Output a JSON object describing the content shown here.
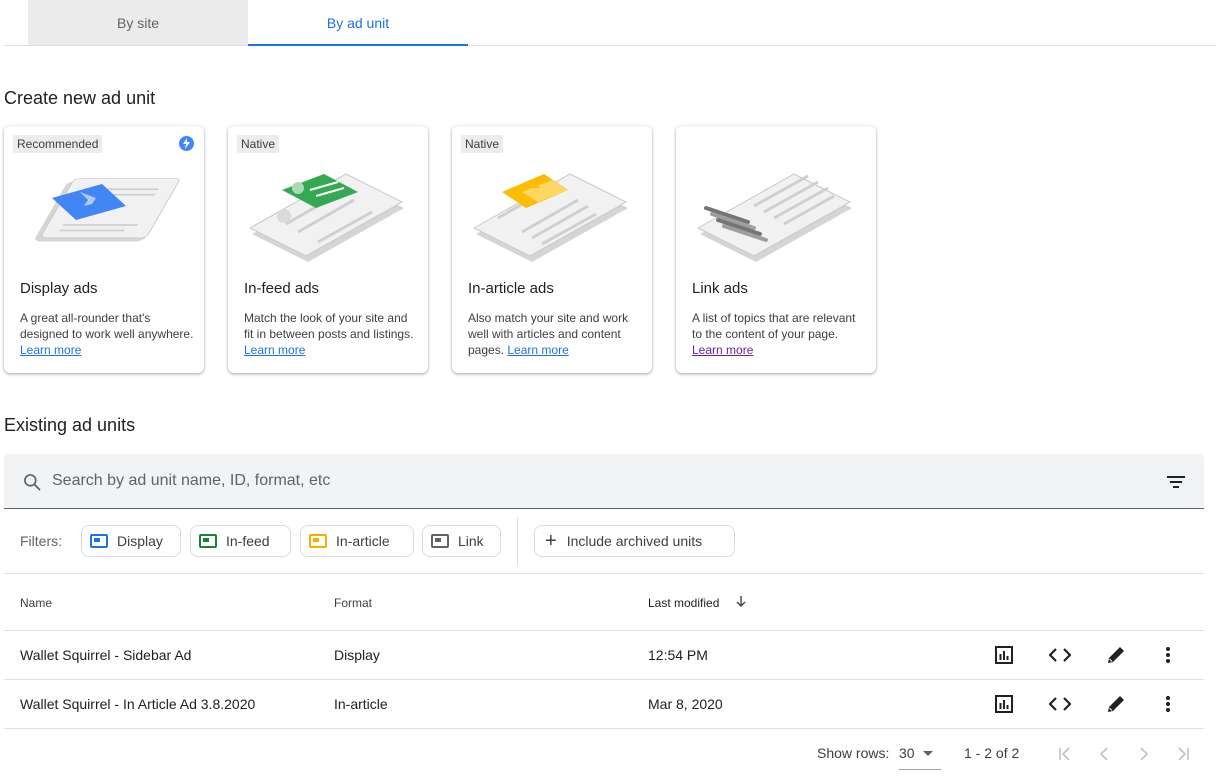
{
  "tabs": [
    {
      "label": "By site",
      "selected": false
    },
    {
      "label": "By ad unit",
      "selected": true
    }
  ],
  "create_section": {
    "title": "Create new ad unit",
    "cards": [
      {
        "badge": "Recommended",
        "title": "Display ads",
        "desc": "A great all-rounder that's designed to work well anywhere.",
        "link": "Learn more",
        "accent": "#4285f4",
        "icon": "bolt-icon"
      },
      {
        "badge": "Native",
        "title": "In-feed ads",
        "desc": "Match the look of your site and fit in between posts and listings.",
        "link": "Learn more",
        "accent": "#34a853"
      },
      {
        "badge": "Native",
        "title": "In-article ads",
        "desc": "Also match your site and work well with articles and content pages.",
        "link": "Learn more",
        "accent": "#fbbc04"
      },
      {
        "badge": "",
        "title": "Link ads",
        "desc": "A list of topics that are relevant to the content of your page.",
        "link": "Learn more",
        "accent": "#9aa0a6"
      }
    ]
  },
  "existing_section": {
    "title": "Existing ad units",
    "search_placeholder": "Search by ad unit name, ID, format, etc",
    "filters_label": "Filters:",
    "filters": [
      {
        "label": "Display",
        "color": "#1a73e8"
      },
      {
        "label": "In-feed",
        "color": "#188038"
      },
      {
        "label": "In-article",
        "color": "#f9ab00"
      },
      {
        "label": "Link",
        "color": "#5f6368"
      }
    ],
    "archived_label": "Include archived units",
    "columns": {
      "name": "Name",
      "format": "Format",
      "modified": "Last modified"
    },
    "rows": [
      {
        "name": "Wallet Squirrel - Sidebar Ad",
        "format": "Display",
        "modified": "12:54 PM"
      },
      {
        "name": "Wallet Squirrel - In Article Ad 3.8.2020",
        "format": "In-article",
        "modified": "Mar 8, 2020"
      }
    ]
  },
  "pagination": {
    "show_rows_label": "Show rows:",
    "rows_value": "30",
    "range": "1 - 2 of 2"
  }
}
